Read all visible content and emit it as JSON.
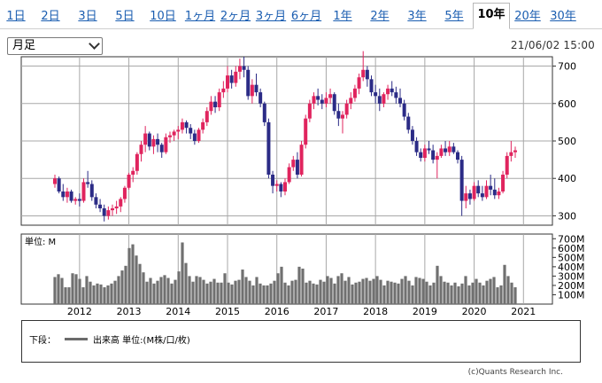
{
  "tabs": [
    {
      "label": "1日",
      "active": false
    },
    {
      "label": "2日",
      "active": false
    },
    {
      "label": "3日",
      "active": false
    },
    {
      "label": "5日",
      "active": false
    },
    {
      "label": "10日",
      "active": false
    },
    {
      "label": "1ヶ月",
      "active": false
    },
    {
      "label": "2ヶ月",
      "active": false
    },
    {
      "label": "3ヶ月",
      "active": false
    },
    {
      "label": "6ヶ月",
      "active": false
    },
    {
      "label": "1年",
      "active": false
    },
    {
      "label": "2年",
      "active": false
    },
    {
      "label": "3年",
      "active": false
    },
    {
      "label": "5年",
      "active": false
    },
    {
      "label": "10年",
      "active": true
    },
    {
      "label": "20年",
      "active": false
    },
    {
      "label": "30年",
      "active": false
    }
  ],
  "period_select": {
    "value": "月足"
  },
  "timestamp": "21/06/02 15:00",
  "legend": {
    "prefix": "下段：",
    "series": "出来高 単位:(M株/口/枚)"
  },
  "copyright": "(c)Quants Research Inc.",
  "colors": {
    "up": "#e0245e",
    "down": "#2b2b86",
    "volume": "#707070",
    "grid": "#a8a8a8"
  },
  "chart_data": [
    {
      "type": "candlestick",
      "interval": "monthly",
      "ylim": [
        275,
        725
      ],
      "yticks": [
        300,
        400,
        500,
        600,
        700
      ],
      "x_labels": [
        "2012",
        "2013",
        "2014",
        "2015",
        "2016",
        "2017",
        "2018",
        "2019",
        "2020",
        "2021"
      ],
      "start": "2011-07",
      "ohlc": [
        [
          385,
          410,
          375,
          400
        ],
        [
          400,
          405,
          360,
          365
        ],
        [
          365,
          385,
          340,
          350
        ],
        [
          350,
          375,
          335,
          365
        ],
        [
          365,
          370,
          335,
          340
        ],
        [
          340,
          350,
          330,
          345
        ],
        [
          345,
          360,
          325,
          340
        ],
        [
          340,
          400,
          335,
          390
        ],
        [
          390,
          420,
          375,
          385
        ],
        [
          385,
          395,
          340,
          350
        ],
        [
          350,
          360,
          320,
          330
        ],
        [
          330,
          345,
          310,
          320
        ],
        [
          320,
          330,
          285,
          300
        ],
        [
          300,
          325,
          290,
          315
        ],
        [
          315,
          330,
          300,
          320
        ],
        [
          320,
          340,
          305,
          325
        ],
        [
          325,
          350,
          310,
          345
        ],
        [
          345,
          380,
          335,
          375
        ],
        [
          375,
          415,
          370,
          410
        ],
        [
          410,
          430,
          390,
          420
        ],
        [
          420,
          470,
          410,
          465
        ],
        [
          465,
          500,
          445,
          490
        ],
        [
          490,
          540,
          470,
          520
        ],
        [
          520,
          525,
          475,
          485
        ],
        [
          485,
          515,
          465,
          505
        ],
        [
          505,
          520,
          470,
          490
        ],
        [
          490,
          495,
          455,
          470
        ],
        [
          470,
          520,
          465,
          510
        ],
        [
          510,
          525,
          495,
          515
        ],
        [
          515,
          530,
          500,
          525
        ],
        [
          525,
          540,
          505,
          530
        ],
        [
          530,
          560,
          520,
          550
        ],
        [
          550,
          555,
          520,
          535
        ],
        [
          535,
          545,
          505,
          520
        ],
        [
          520,
          530,
          490,
          500
        ],
        [
          500,
          535,
          495,
          530
        ],
        [
          530,
          560,
          520,
          550
        ],
        [
          550,
          590,
          540,
          580
        ],
        [
          580,
          620,
          570,
          605
        ],
        [
          605,
          620,
          575,
          590
        ],
        [
          590,
          640,
          580,
          630
        ],
        [
          630,
          660,
          615,
          640
        ],
        [
          640,
          700,
          630,
          675
        ],
        [
          675,
          690,
          640,
          655
        ],
        [
          655,
          700,
          645,
          685
        ],
        [
          685,
          720,
          665,
          700
        ],
        [
          700,
          725,
          670,
          690
        ],
        [
          690,
          700,
          610,
          620
        ],
        [
          620,
          665,
          600,
          650
        ],
        [
          650,
          680,
          620,
          630
        ],
        [
          630,
          640,
          590,
          600
        ],
        [
          600,
          605,
          540,
          550
        ],
        [
          550,
          560,
          400,
          410
        ],
        [
          410,
          420,
          360,
          380
        ],
        [
          380,
          395,
          365,
          385
        ],
        [
          385,
          390,
          350,
          365
        ],
        [
          365,
          400,
          355,
          390
        ],
        [
          390,
          440,
          385,
          430
        ],
        [
          430,
          460,
          420,
          450
        ],
        [
          450,
          470,
          400,
          410
        ],
        [
          410,
          500,
          405,
          490
        ],
        [
          490,
          570,
          480,
          560
        ],
        [
          560,
          610,
          550,
          600
        ],
        [
          600,
          630,
          585,
          620
        ],
        [
          620,
          640,
          595,
          610
        ],
        [
          610,
          625,
          585,
          600
        ],
        [
          600,
          630,
          590,
          615
        ],
        [
          615,
          640,
          600,
          625
        ],
        [
          625,
          630,
          570,
          580
        ],
        [
          580,
          600,
          540,
          560
        ],
        [
          560,
          580,
          520,
          570
        ],
        [
          570,
          610,
          560,
          600
        ],
        [
          600,
          630,
          585,
          615
        ],
        [
          615,
          650,
          605,
          640
        ],
        [
          640,
          680,
          625,
          670
        ],
        [
          670,
          740,
          660,
          690
        ],
        [
          690,
          700,
          645,
          665
        ],
        [
          665,
          675,
          620,
          630
        ],
        [
          630,
          650,
          600,
          620
        ],
        [
          620,
          640,
          580,
          600
        ],
        [
          600,
          630,
          590,
          625
        ],
        [
          625,
          650,
          610,
          640
        ],
        [
          640,
          660,
          620,
          630
        ],
        [
          630,
          645,
          600,
          615
        ],
        [
          615,
          640,
          590,
          600
        ],
        [
          600,
          610,
          555,
          565
        ],
        [
          565,
          575,
          520,
          530
        ],
        [
          530,
          540,
          490,
          500
        ],
        [
          500,
          510,
          460,
          470
        ],
        [
          470,
          480,
          445,
          455
        ],
        [
          455,
          490,
          445,
          480
        ],
        [
          480,
          500,
          465,
          475
        ],
        [
          475,
          490,
          440,
          450
        ],
        [
          450,
          470,
          400,
          460
        ],
        [
          460,
          490,
          455,
          480
        ],
        [
          480,
          500,
          460,
          470
        ],
        [
          470,
          500,
          460,
          485
        ],
        [
          485,
          495,
          465,
          470
        ],
        [
          470,
          475,
          440,
          450
        ],
        [
          450,
          460,
          300,
          340
        ],
        [
          340,
          380,
          320,
          360
        ],
        [
          360,
          370,
          330,
          345
        ],
        [
          345,
          390,
          340,
          380
        ],
        [
          380,
          395,
          350,
          360
        ],
        [
          360,
          380,
          340,
          350
        ],
        [
          350,
          395,
          345,
          380
        ],
        [
          380,
          410,
          355,
          370
        ],
        [
          370,
          400,
          345,
          355
        ],
        [
          355,
          375,
          345,
          365
        ],
        [
          365,
          420,
          360,
          410
        ],
        [
          410,
          470,
          400,
          460
        ],
        [
          460,
          500,
          445,
          470
        ],
        [
          470,
          485,
          455,
          475
        ]
      ]
    },
    {
      "type": "bar",
      "series_name": "出来高",
      "unit_label": "単位: M",
      "ylim": [
        0,
        750
      ],
      "yticks": [
        "100M",
        "200M",
        "300M",
        "400M",
        "500M",
        "600M",
        "700M"
      ],
      "values": [
        290,
        320,
        280,
        180,
        180,
        330,
        320,
        270,
        180,
        300,
        240,
        200,
        220,
        210,
        180,
        200,
        220,
        250,
        300,
        360,
        410,
        600,
        640,
        520,
        430,
        340,
        240,
        280,
        220,
        250,
        290,
        310,
        280,
        220,
        260,
        350,
        660,
        440,
        300,
        240,
        300,
        290,
        260,
        220,
        240,
        270,
        230,
        230,
        330,
        230,
        210,
        250,
        260,
        370,
        290,
        250,
        200,
        290,
        220,
        200,
        200,
        220,
        250,
        330,
        400,
        230,
        200,
        250,
        260,
        400,
        380,
        230,
        250,
        220,
        210,
        260,
        240,
        300,
        280,
        220,
        300,
        330,
        250,
        290,
        210,
        230,
        240,
        270,
        280,
        250,
        270,
        300,
        260,
        200,
        250,
        240,
        230,
        220,
        270,
        300,
        250,
        200,
        290,
        280,
        270,
        240,
        200,
        230,
        410,
        300,
        240,
        230,
        200,
        230,
        190,
        220,
        300,
        200,
        230,
        270,
        230,
        200,
        250,
        270,
        290,
        180,
        200,
        420,
        300,
        230,
        180
      ]
    }
  ]
}
